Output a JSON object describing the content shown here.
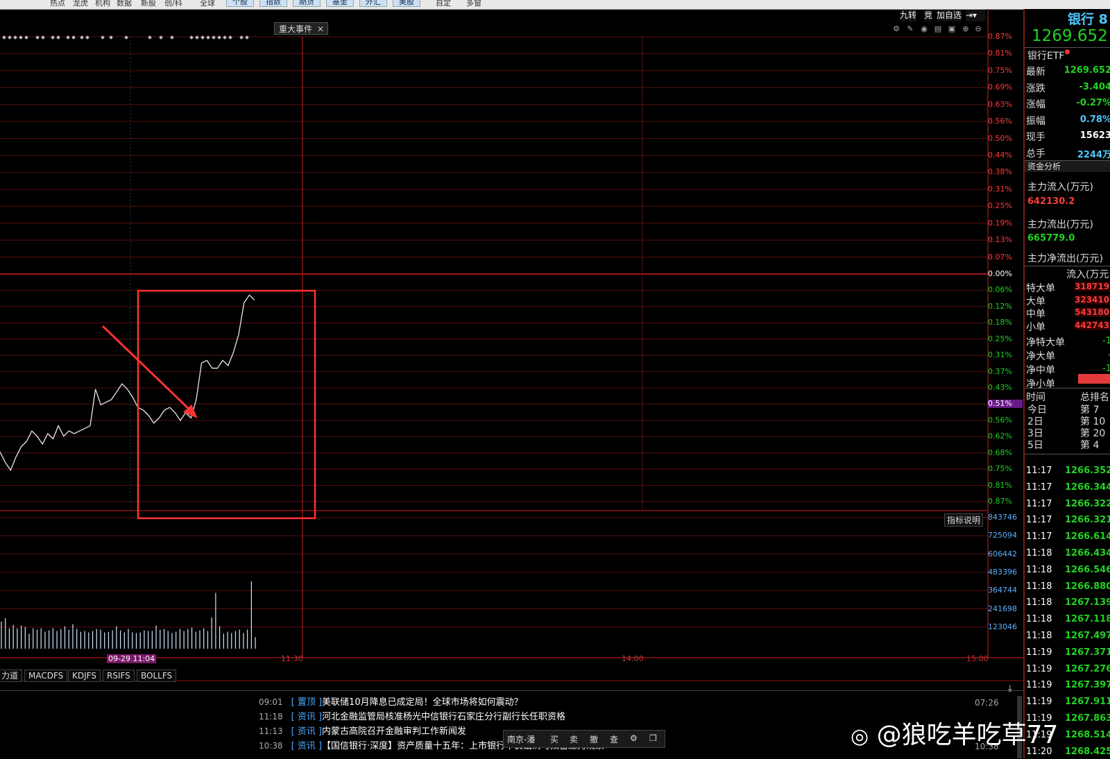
{
  "menu": [
    "热点",
    "龙虎",
    "机构",
    "数据",
    "新股",
    "创/科",
    "全球"
  ],
  "menu_buttons": [
    "个股",
    "指数",
    "期货",
    "基金",
    "外汇",
    "美股"
  ],
  "menu_tail": [
    "自定",
    "多窗"
  ],
  "event_tag": "重大事件",
  "event_close": "✕",
  "top_buttons": {
    "jiuzhuan": "九转",
    "jing": "竞",
    "add_watch": "加自选"
  },
  "pct_labels": [
    "0.87%",
    "0.81%",
    "0.75%",
    "0.69%",
    "0.63%",
    "0.56%",
    "0.50%",
    "0.44%",
    "0.38%",
    "0.31%",
    "0.25%",
    "0.19%",
    "0.13%",
    "0.07%",
    "0.00%",
    "0.06%",
    "0.12%",
    "0.18%",
    "0.25%",
    "0.31%",
    "0.37%",
    "0.43%",
    "0.51%",
    "0.56%",
    "0.62%",
    "0.68%",
    "0.75%",
    "0.81%",
    "0.87%"
  ],
  "highlight_pct": "0.51%",
  "volume_labels": [
    "843746",
    "725094",
    "606442",
    "483396",
    "364744",
    "241698",
    "123046"
  ],
  "indicator_note": "指标说明",
  "time_labels": {
    "cursor": "09-29 11:04",
    "t1": "11:30",
    "t2": "14:00",
    "t3": "15:00"
  },
  "indicator_tabs": [
    "力道",
    "MACDFS",
    "KDJFS",
    "RSIFS",
    "BOLLFS"
  ],
  "news": [
    {
      "time": "09:01",
      "tag": "置顶",
      "text": "美联储10月降息已成定局！全球市场将如何震动？",
      "rtime": "07:26"
    },
    {
      "time": "11:18",
      "tag": "资讯",
      "text": "河北金融监管局核准杨光中信银行石家庄分行副行长任职资格",
      "rtime": ""
    },
    {
      "time": "11:13",
      "tag": "资讯",
      "text": "内蒙古高院召开金融审判工作新闻发",
      "rtime": ""
    },
    {
      "time": "10:38",
      "tag": "资讯",
      "text": "【国信银行·深度】资产质量十五年：上市银行不良出清与拨备压力观察",
      "rtime": "10:38"
    }
  ],
  "float_bar": {
    "account": "南京-潘",
    "buy": "买",
    "sell": "卖",
    "cancel": "撤",
    "query": "查"
  },
  "right": {
    "name": "银行 8",
    "price": "1269.652",
    "etf": "银行ETF",
    "quotes": [
      {
        "label": "最新",
        "value": "1269.652",
        "color": "#21d321"
      },
      {
        "label": "涨跌",
        "value": "-3.404",
        "color": "#21d321"
      },
      {
        "label": "涨幅",
        "value": "-0.27%",
        "color": "#21d321"
      },
      {
        "label": "振幅",
        "value": "0.78%",
        "color": "#4ec8ff"
      },
      {
        "label": "现手",
        "value": "15623",
        "color": "#ffffff"
      },
      {
        "label": "总手",
        "value": "2244万",
        "color": "#4ec8ff"
      }
    ],
    "fund_title": "资金分析",
    "inflow_label": "主力流入(万元)",
    "inflow_value": "642130.2",
    "outflow_label": "主力流出(万元)",
    "outflow_value": "665779.0",
    "net_label": "主力净流出(万元)",
    "flow_header": "流入(万元",
    "flows": [
      {
        "label": "特大单",
        "value": "318719"
      },
      {
        "label": "大单",
        "value": "323410"
      },
      {
        "label": "中单",
        "value": "543180"
      },
      {
        "label": "小单",
        "value": "442743"
      }
    ],
    "nets": [
      {
        "label": "净特大单",
        "value": "-1"
      },
      {
        "label": "净大单",
        "value": "-"
      },
      {
        "label": "净中单",
        "value": "-1"
      },
      {
        "label": "净小单",
        "value": ""
      }
    ],
    "rank_header": {
      "time": "时间",
      "rank": "总排名"
    },
    "ranks": [
      {
        "label": "今日",
        "value": "第 7"
      },
      {
        "label": "2日",
        "value": "第 10"
      },
      {
        "label": "3日",
        "value": "第 20"
      },
      {
        "label": "5日",
        "value": "第 4"
      }
    ],
    "ticks": [
      [
        "11:17",
        "1266.352"
      ],
      [
        "11:17",
        "1266.344"
      ],
      [
        "11:17",
        "1266.322"
      ],
      [
        "11:17",
        "1266.321"
      ],
      [
        "11:17",
        "1266.614"
      ],
      [
        "11:18",
        "1266.434"
      ],
      [
        "11:18",
        "1266.546"
      ],
      [
        "11:18",
        "1266.880"
      ],
      [
        "11:18",
        "1267.139"
      ],
      [
        "11:18",
        "1267.118"
      ],
      [
        "11:18",
        "1267.497"
      ],
      [
        "11:19",
        "1267.371"
      ],
      [
        "11:19",
        "1267.276"
      ],
      [
        "11:19",
        "1267.397"
      ],
      [
        "11:19",
        "1267.911"
      ],
      [
        "11:19",
        "1267.863"
      ],
      [
        "11:19",
        "1268.514"
      ],
      [
        "11:20",
        "1268.425"
      ]
    ]
  },
  "watermark": "@狼吃羊吃草77",
  "chart_data": {
    "type": "line",
    "title": "",
    "series": [
      {
        "values": [
          -0.68,
          -0.72,
          -0.75,
          -0.7,
          -0.66,
          -0.64,
          -0.6,
          -0.62,
          -0.65,
          -0.61,
          -0.63,
          -0.58,
          -0.62,
          -0.6,
          -0.61,
          -0.6,
          -0.59,
          -0.58,
          -0.44,
          -0.5,
          -0.49,
          -0.48,
          -0.45,
          -0.42,
          -0.44,
          -0.47,
          -0.51,
          -0.52,
          -0.54,
          -0.57,
          -0.55,
          -0.52,
          -0.51,
          -0.53,
          -0.56,
          -0.53,
          -0.55,
          -0.48,
          -0.34,
          -0.33,
          -0.36,
          -0.36,
          -0.33,
          -0.35,
          -0.3,
          -0.23,
          -0.11,
          -0.08,
          -0.1
        ]
      }
    ],
    "volume": [
      0.4,
      0.45,
      0.3,
      0.35,
      0.3,
      0.34,
      0.32,
      0.22,
      0.3,
      0.28,
      0.3,
      0.25,
      0.27,
      0.3,
      0.26,
      0.29,
      0.33,
      0.28,
      0.36,
      0.29,
      0.25,
      0.26,
      0.24,
      0.26,
      0.29,
      0.28,
      0.24,
      0.25,
      0.27,
      0.33,
      0.27,
      0.24,
      0.29,
      0.24,
      0.23,
      0.24,
      0.27,
      0.26,
      0.26,
      0.34,
      0.28,
      0.29,
      0.26,
      0.23,
      0.25,
      0.29,
      0.26,
      0.29,
      0.31,
      0.25,
      0.27,
      0.3,
      0.26,
      0.46,
      0.82,
      0.33,
      0.22,
      0.25,
      0.23,
      0.26,
      0.28,
      0.23,
      0.28,
      0.99,
      0.17
    ],
    "y_range_pct": [
      -0.87,
      0.87
    ]
  }
}
